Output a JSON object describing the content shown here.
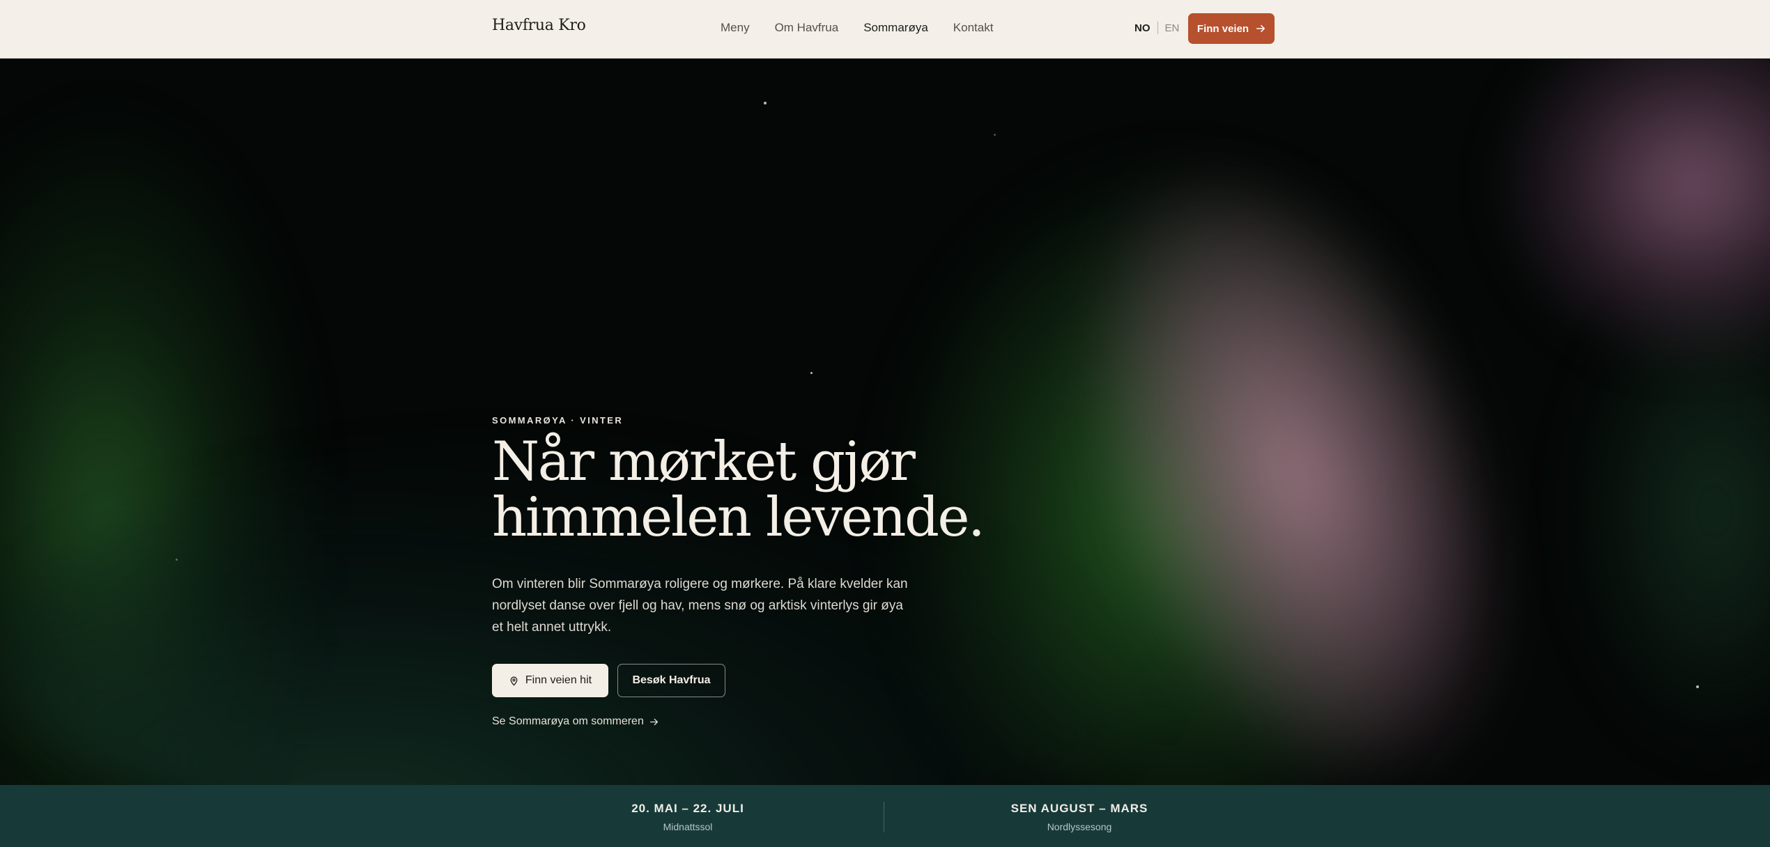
{
  "nav": {
    "brand": "Havfrua Kro",
    "items": [
      {
        "label": "Meny",
        "active": false
      },
      {
        "label": "Om Havfrua",
        "active": false
      },
      {
        "label": "Sommarøya",
        "active": true
      },
      {
        "label": "Kontakt",
        "active": false
      }
    ],
    "lang_active": "NO",
    "lang_other": "EN",
    "cta_label": "Finn veien",
    "cta_icon": "arrow-right-icon"
  },
  "hero": {
    "eyebrow": "SOMMARØYA · VINTER",
    "headline_line1": "Når mørket gjør",
    "headline_line2": "himmelen levende.",
    "lede": "Om vinteren blir Sommarøya roligere og mørkere. På klare kvelder kan nordlyset danse over fjell og hav, mens snø og arktisk vinterlys gir øya et helt annet uttrykk.",
    "primary_button": "Finn veien hit",
    "primary_icon": "map-pin-icon",
    "secondary_button": "Besøk Havfrua",
    "summer_link": "Se Sommarøya om sommeren",
    "summer_icon": "arrow-right-icon"
  },
  "seasons": [
    {
      "date": "20. MAI – 22. JULI",
      "label": "Midnattssol"
    },
    {
      "date": "SEN AUGUST – MARS",
      "label": "Nordlyssesong"
    }
  ],
  "colors": {
    "nav_bg": "#f4f0e9",
    "accent": "#b6502d",
    "strip_bg": "#173a39",
    "aurora_green": "#2c7628",
    "aurora_pink": "#b27e96"
  }
}
